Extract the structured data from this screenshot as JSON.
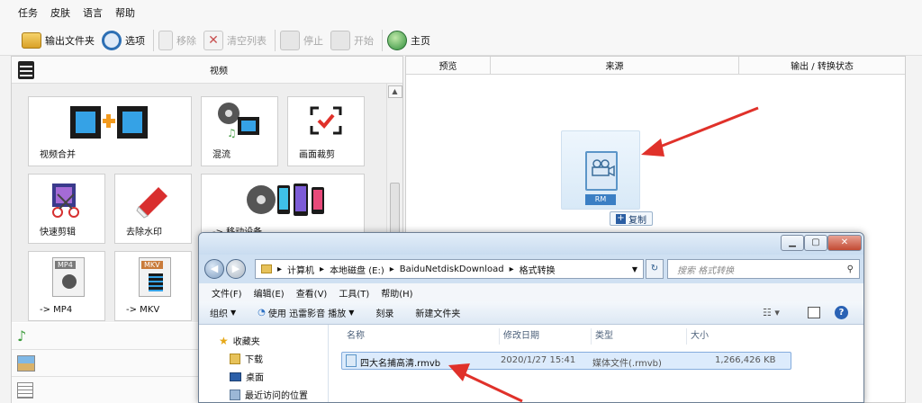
{
  "menubar": {
    "items": [
      "任务",
      "皮肤",
      "语言",
      "帮助"
    ]
  },
  "toolbar": {
    "output_folder": "输出文件夹",
    "options": "选项",
    "remove": "移除",
    "clear_list": "清空列表",
    "stop": "停止",
    "start": "开始",
    "home": "主页"
  },
  "left_panel": {
    "title": "视频",
    "tiles": {
      "merge": "视频合并",
      "mix": "混流",
      "crop": "画面裁剪",
      "quick_cut": "快速剪辑",
      "watermark": "去除水印",
      "mobile": "-> 移动设备",
      "mp4": "-> MP4",
      "mkv": "-> MKV",
      "mp4_badge": "MP4",
      "mkv_badge": "MKV"
    }
  },
  "right_panel": {
    "columns": [
      "预览",
      "来源",
      "输出 / 转换状态"
    ],
    "drop_badge": "RM",
    "copy_label": "复制"
  },
  "explorer": {
    "path": [
      "计算机",
      "本地磁盘 (E:)",
      "BaiduNetdiskDownload",
      "格式转换"
    ],
    "search_placeholder": "搜索 格式转换",
    "menu": [
      "文件(F)",
      "编辑(E)",
      "查看(V)",
      "工具(T)",
      "帮助(H)"
    ],
    "commands": {
      "organize": "组织",
      "open_with": "使用 迅雷影音 播放",
      "burn": "刻录",
      "new_folder": "新建文件夹"
    },
    "nav": [
      "收藏夹",
      "下载",
      "桌面",
      "最近访问的位置"
    ],
    "headers": [
      "名称",
      "修改日期",
      "类型",
      "大小"
    ],
    "file": {
      "name": "四大名捕高清.rmvb",
      "date": "2020/1/27 15:41",
      "type": "媒体文件(.rmvb)",
      "size": "1,266,426 KB"
    }
  },
  "colors": {
    "accent_red": "#e0312a",
    "selection_blue": "#dcebfc",
    "window_frame": "#cfe0f2"
  }
}
